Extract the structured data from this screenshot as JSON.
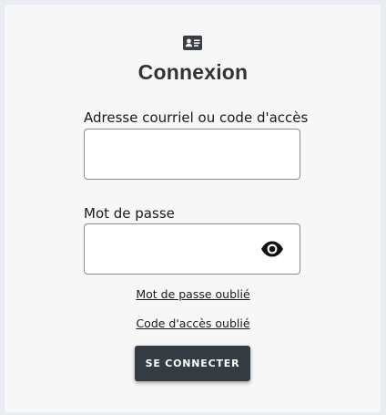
{
  "login_form": {
    "icon": "id-card-icon",
    "title": "Connexion",
    "email_label": "Adresse courriel ou code d'accès",
    "email_value": "",
    "password_label": "Mot de passe",
    "password_value": "",
    "show_password_icon": "eye-icon",
    "forgot_password_link": "Mot de passe oublié",
    "forgot_code_link": "Code d'accès oublié",
    "submit_label": "SE CONNECTER"
  },
  "colors": {
    "page_background": "#e9ecf1",
    "card_background": "#f7f7f7",
    "button_background": "#353b43",
    "text": "#1a1a1a"
  }
}
